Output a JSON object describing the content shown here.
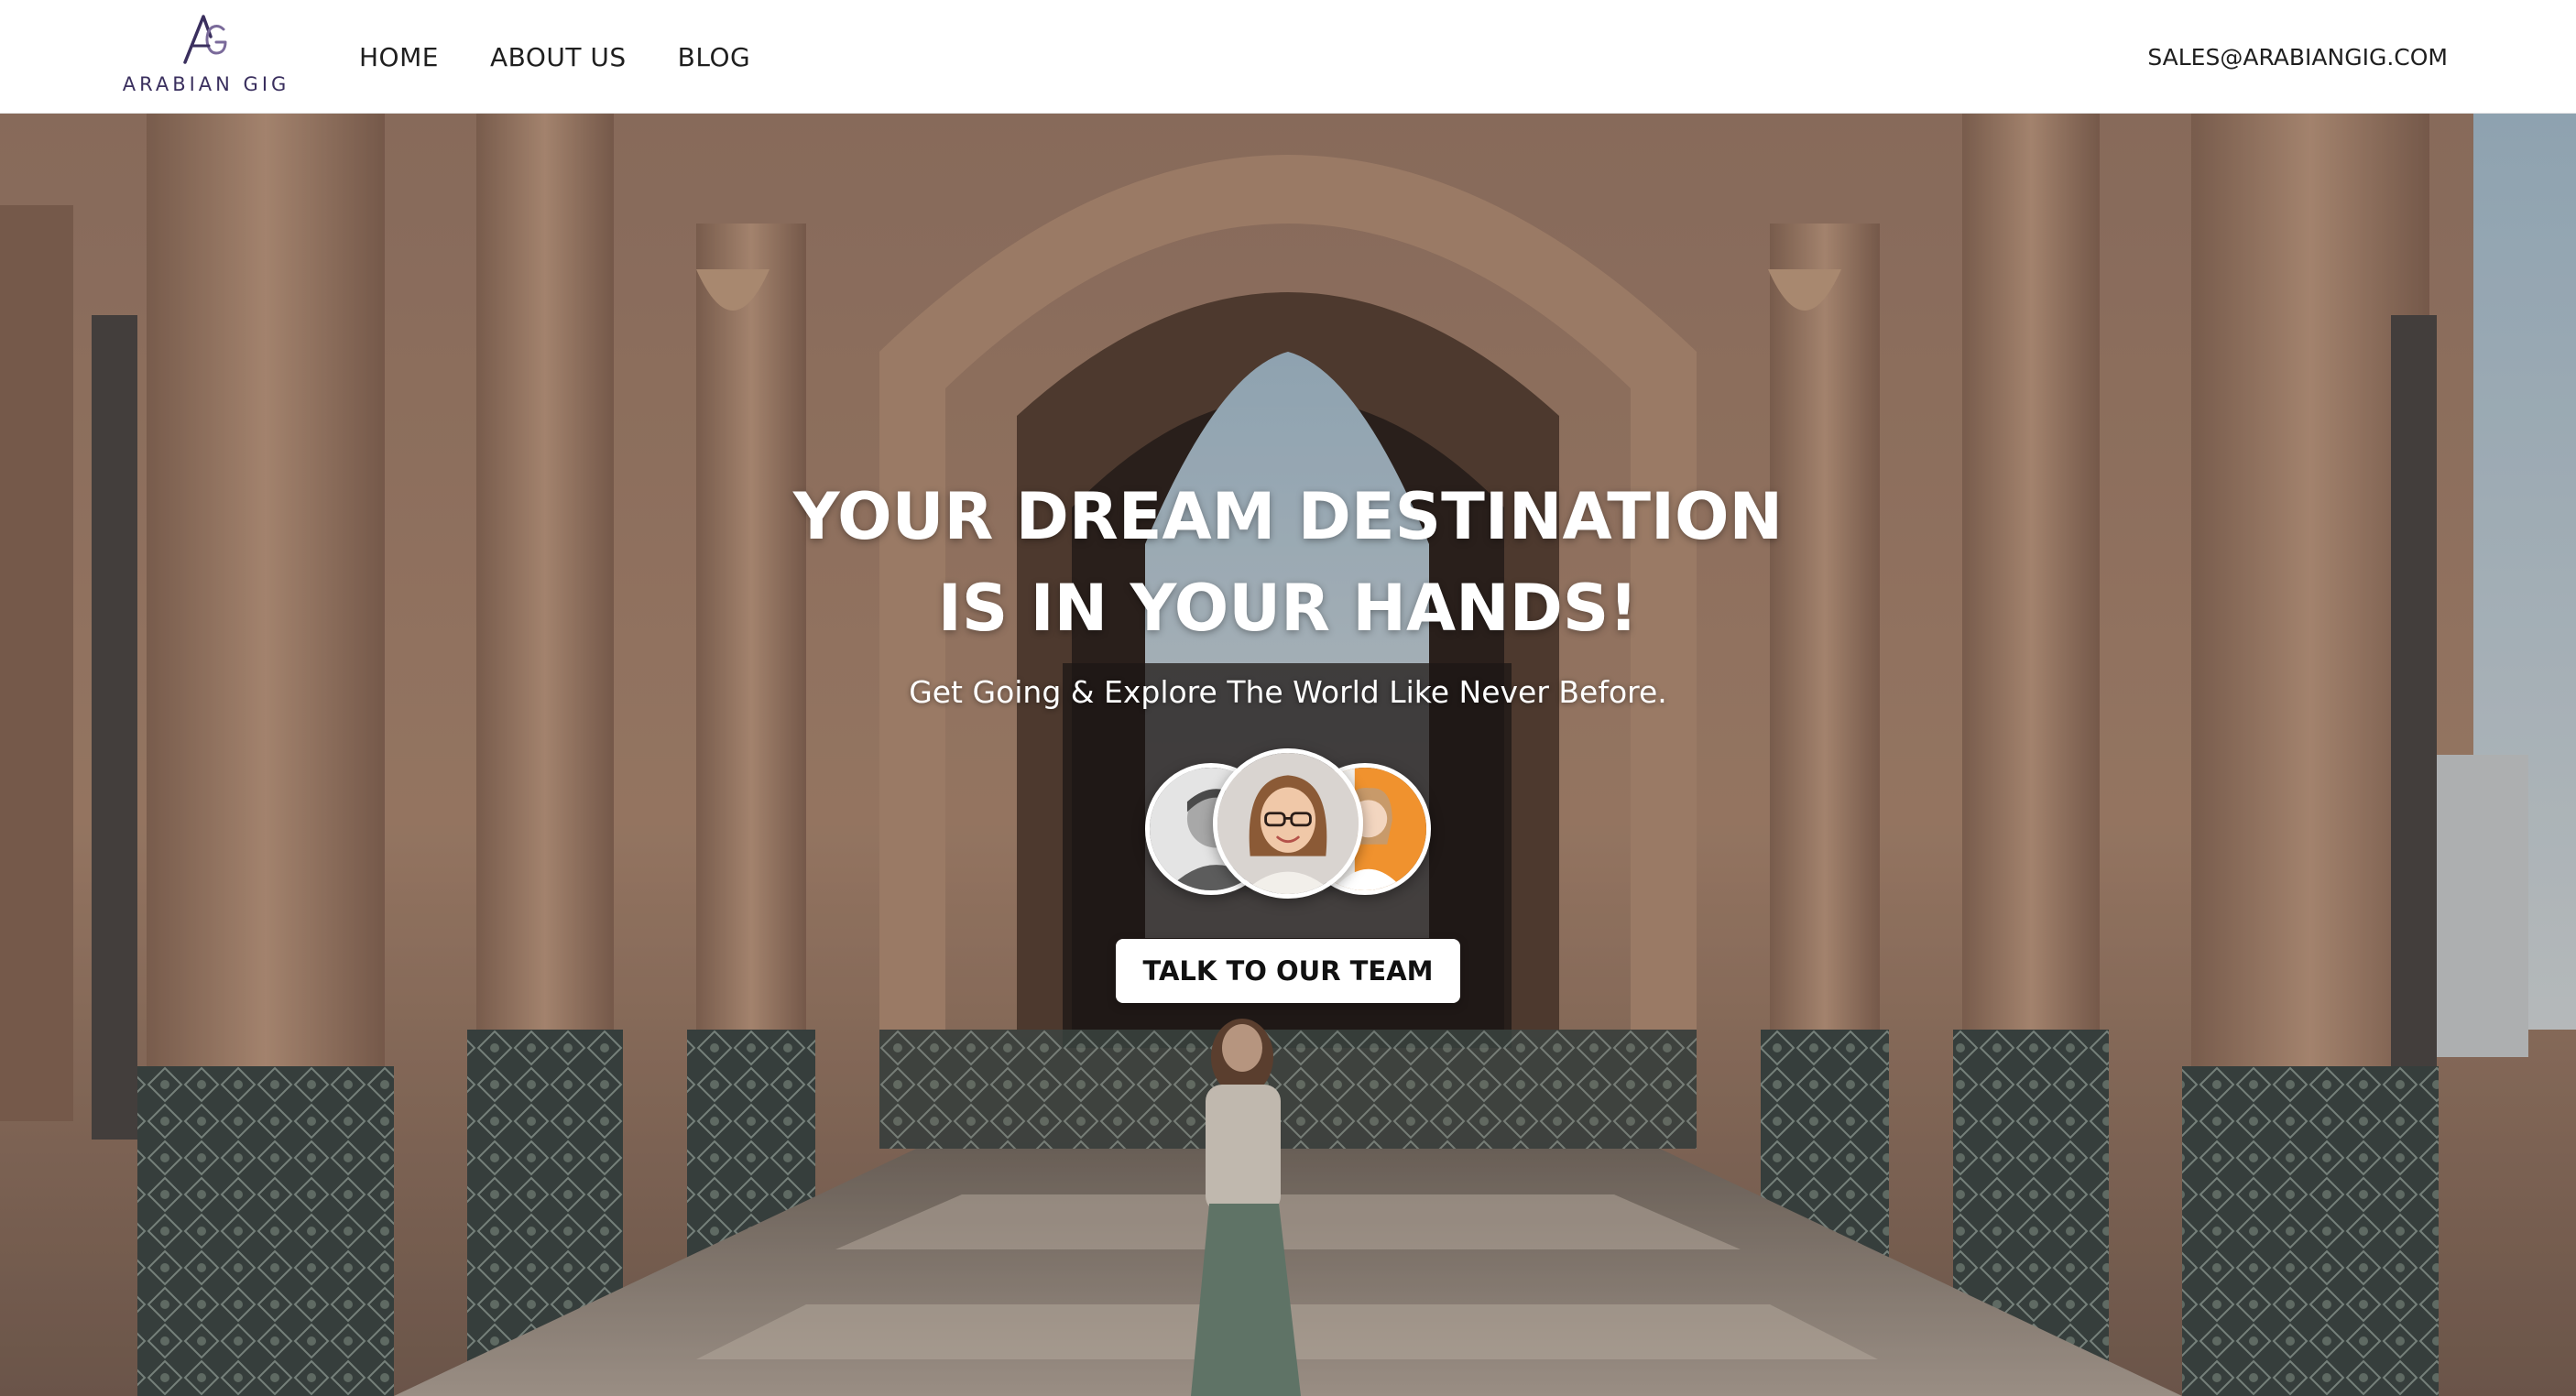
{
  "brand": {
    "logo_text": "ARABIAN GIG"
  },
  "nav": {
    "items": [
      {
        "label": "HOME"
      },
      {
        "label": "ABOUT US"
      },
      {
        "label": "BLOG"
      }
    ]
  },
  "header": {
    "contact_email": "SALES@ARABIANGIG.COM"
  },
  "hero": {
    "title": "YOUR DREAM DESTINATION IS IN YOUR HANDS!",
    "subtitle": "Get Going & Explore The World Like Never Before.",
    "cta_label": "TALK TO OUR TEAM",
    "avatars": [
      {
        "name": "team-avatar-man",
        "accent": "#9e9e9e"
      },
      {
        "name": "team-avatar-woman-glasses",
        "accent": "#c9c2bd"
      },
      {
        "name": "team-avatar-woman-orange",
        "accent": "#f0922e"
      }
    ]
  },
  "colors": {
    "brand_purple": "#3a2f5e",
    "header_bg": "#ffffff",
    "cta_bg": "#ffffff",
    "hero_text": "#ffffff"
  }
}
